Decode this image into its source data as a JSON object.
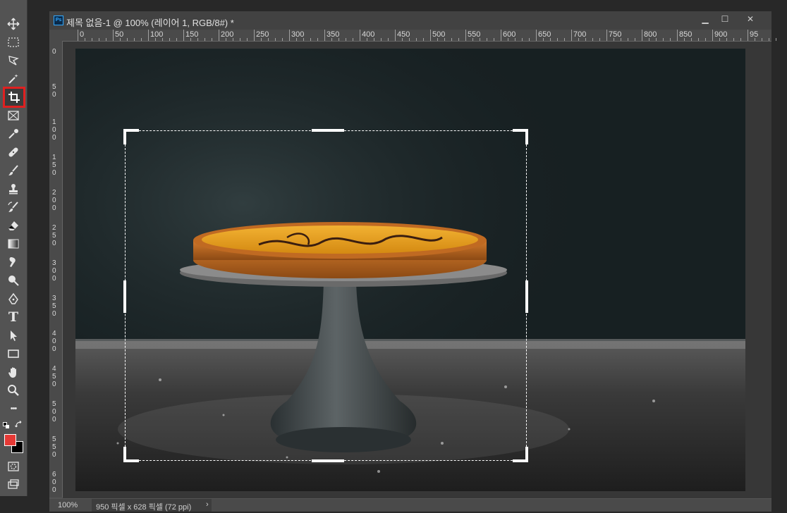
{
  "document": {
    "ps_badge": "Ps",
    "title": "제목 없음-1 @ 100% (레이어 1, RGB/8#) *",
    "window_controls": {
      "minimize": "▁",
      "maximize": "☐",
      "close": "✕"
    }
  },
  "ruler": {
    "h_labels": [
      "0",
      "50",
      "100",
      "150",
      "200",
      "250",
      "300",
      "350",
      "400",
      "450",
      "500",
      "550",
      "600",
      "650",
      "700",
      "750",
      "800",
      "850",
      "900",
      "95"
    ],
    "v_labels": [
      {
        "label": "0",
        "digits": [
          "0"
        ]
      },
      {
        "label": "50",
        "digits": [
          "5",
          "0"
        ]
      },
      {
        "label": "100",
        "digits": [
          "1",
          "0",
          "0"
        ]
      },
      {
        "label": "150",
        "digits": [
          "1",
          "5",
          "0"
        ]
      },
      {
        "label": "200",
        "digits": [
          "2",
          "0",
          "0"
        ]
      },
      {
        "label": "250",
        "digits": [
          "2",
          "5",
          "0"
        ]
      },
      {
        "label": "300",
        "digits": [
          "3",
          "0",
          "0"
        ]
      },
      {
        "label": "350",
        "digits": [
          "3",
          "5",
          "0"
        ]
      },
      {
        "label": "400",
        "digits": [
          "4",
          "0",
          "0"
        ]
      },
      {
        "label": "450",
        "digits": [
          "4",
          "5",
          "0"
        ]
      },
      {
        "label": "500",
        "digits": [
          "5",
          "0",
          "0"
        ]
      },
      {
        "label": "550",
        "digits": [
          "5",
          "5",
          "0"
        ]
      },
      {
        "label": "600",
        "digits": [
          "6",
          "0",
          "0"
        ]
      }
    ]
  },
  "status": {
    "zoom": "100%",
    "doc_info": "950 픽셀 x 628 픽셀 (72 ppi)",
    "chevron": "›"
  },
  "tools": [
    {
      "name": "move-tool",
      "icon": "move-icon",
      "active": false
    },
    {
      "name": "marquee-tool",
      "icon": "rect-marquee-icon",
      "active": false
    },
    {
      "name": "lasso-tool",
      "icon": "polygonal-lasso-icon",
      "active": false
    },
    {
      "name": "magic-wand-tool",
      "icon": "magic-wand-icon",
      "active": false
    },
    {
      "name": "crop-tool",
      "icon": "crop-icon",
      "active": true
    },
    {
      "name": "frame-tool",
      "icon": "frame-icon",
      "active": false
    },
    {
      "name": "eyedropper-tool",
      "icon": "eyedropper-icon",
      "active": false
    },
    {
      "name": "healing-tool",
      "icon": "bandage-icon",
      "active": false
    },
    {
      "name": "brush-tool",
      "icon": "brush-icon",
      "active": false
    },
    {
      "name": "stamp-tool",
      "icon": "stamp-icon",
      "active": false
    },
    {
      "name": "history-brush-tool",
      "icon": "history-brush-icon",
      "active": false
    },
    {
      "name": "eraser-tool",
      "icon": "eraser-icon",
      "active": false
    },
    {
      "name": "gradient-tool",
      "icon": "gradient-icon",
      "active": false
    },
    {
      "name": "blur-tool",
      "icon": "smudge-icon",
      "active": false
    },
    {
      "name": "dodge-tool",
      "icon": "dodge-icon",
      "active": false
    },
    {
      "name": "pen-tool",
      "icon": "pen-icon",
      "active": false
    },
    {
      "name": "type-tool",
      "icon": "type-icon",
      "glyph": "T",
      "active": false
    },
    {
      "name": "path-select-tool",
      "icon": "path-select-icon",
      "active": false
    },
    {
      "name": "shape-tool",
      "icon": "rectangle-icon",
      "active": false
    },
    {
      "name": "hand-tool",
      "icon": "hand-icon",
      "active": false
    },
    {
      "name": "zoom-tool",
      "icon": "zoom-icon",
      "active": false
    },
    {
      "name": "more-tools",
      "icon": "ellipsis-icon",
      "glyph": "•••",
      "active": false
    }
  ],
  "colors": {
    "foreground": "#e53935",
    "background": "#000000",
    "highlight": "#e02020",
    "arrow": "#ef2b2b"
  },
  "canvas": {
    "image": "dark-tart-on-cake-stand"
  }
}
